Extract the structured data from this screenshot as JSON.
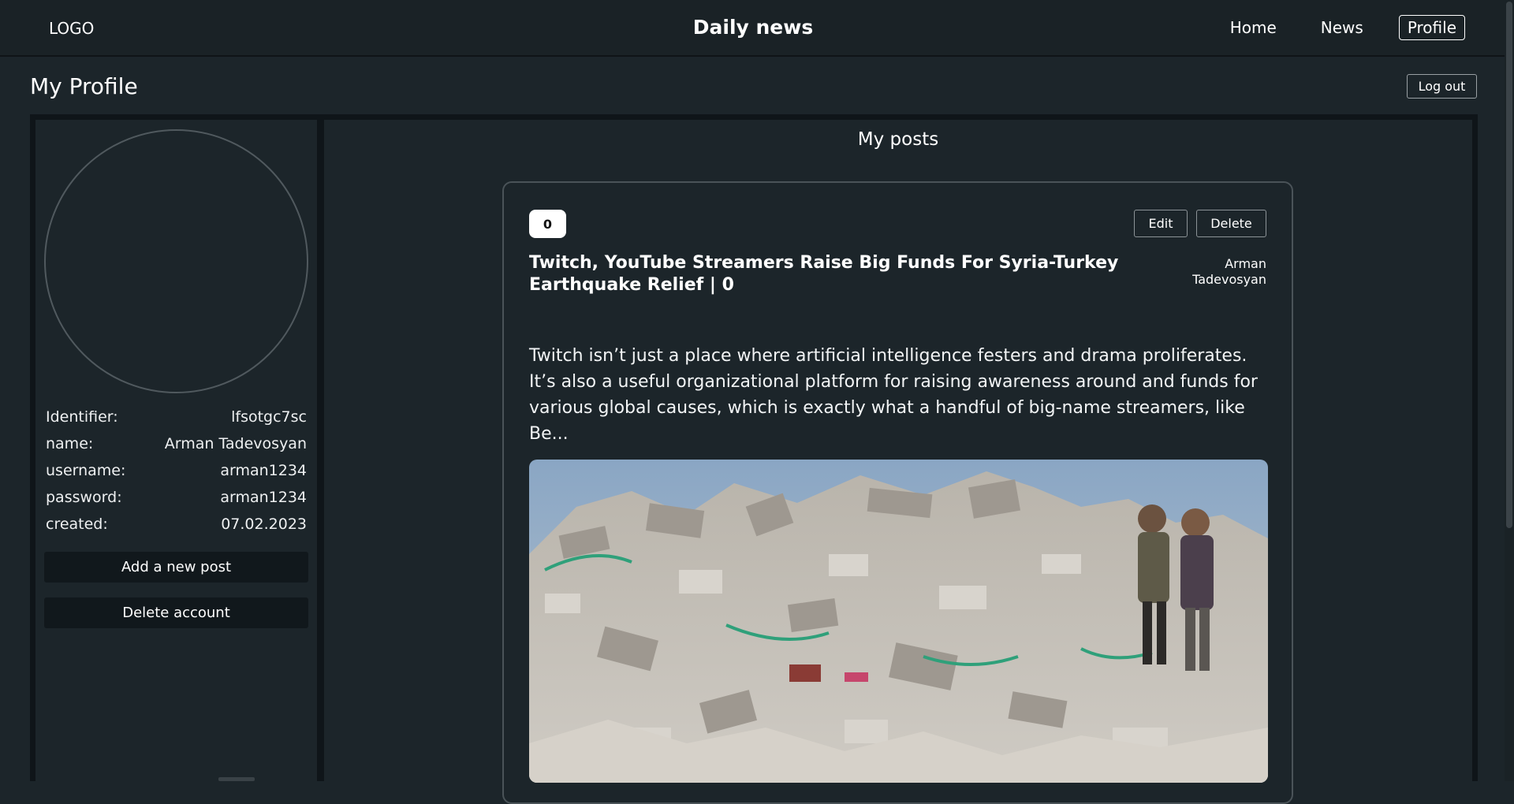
{
  "header": {
    "logo": "LOGO",
    "site_title": "Daily news",
    "nav": {
      "home": "Home",
      "news": "News",
      "profile": "Profile"
    }
  },
  "profile": {
    "page_title": "My Profile",
    "logout_label": "Log out",
    "info": [
      {
        "label": "Identifier:",
        "value": "lfsotgc7sc"
      },
      {
        "label": "name:",
        "value": "Arman Tadevosyan"
      },
      {
        "label": "username:",
        "value": "arman1234"
      },
      {
        "label": "password:",
        "value": "arman1234"
      },
      {
        "label": "created:",
        "value": "07.02.2023"
      }
    ],
    "add_post_label": "Add a new post",
    "delete_account_label": "Delete account"
  },
  "posts": {
    "heading": "My posts",
    "items": [
      {
        "counter": "0",
        "edit_label": "Edit",
        "delete_label": "Delete",
        "title": "Twitch, YouTube Streamers Raise Big Funds For Syria-Turkey Earthquake Relief | 0",
        "author": "Arman Tadevosyan",
        "excerpt": "Twitch isn’t just a place where artificial intelligence festers and drama proliferates. It’s also a useful organizational platform for raising awareness around and funds for various global causes, which is exactly what a handful of big-name streamers, like Be...",
        "image_description": "earthquake-rubble-photo"
      }
    ]
  },
  "colors": {
    "background": "#1c252a",
    "header_bg": "#1a2226",
    "frame_border": "#0f1519",
    "button_dark": "#11181c"
  }
}
